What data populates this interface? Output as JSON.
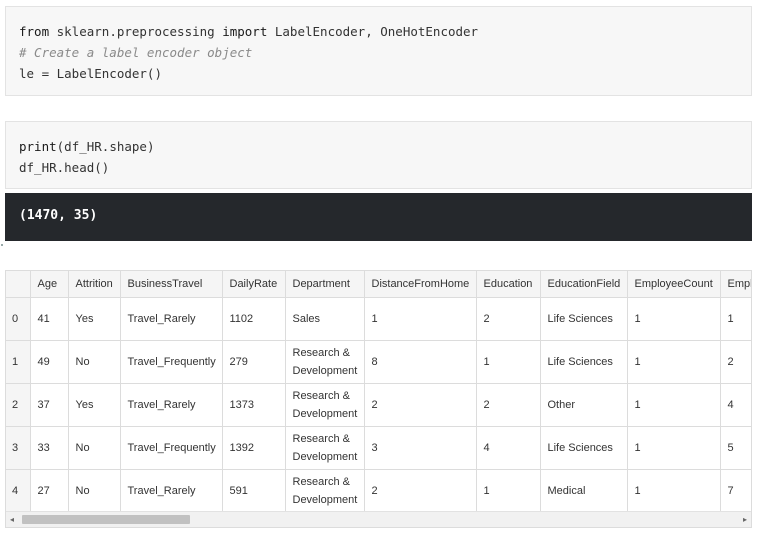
{
  "cell1": {
    "line1": {
      "kw1": "from",
      "t1": " sklearn.preprocessing ",
      "kw2": "import",
      "t2": " LabelEncoder, OneHotEncoder"
    },
    "line2": "# Create a label encoder object",
    "line3": "le = LabelEncoder()"
  },
  "cell2": {
    "line1": {
      "kw": "print",
      "t": "(df_HR.shape)"
    },
    "line2": "df_HR.head()"
  },
  "output_shape": "(1470, 35)",
  "table": {
    "columns": [
      "",
      "Age",
      "Attrition",
      "BusinessTravel",
      "DailyRate",
      "Department",
      "DistanceFromHome",
      "Education",
      "EducationField",
      "EmployeeCount",
      "Emplo"
    ],
    "rows": [
      [
        "0",
        "41",
        "Yes",
        "Travel_Rarely",
        "1102",
        "Sales",
        "1",
        "2",
        "Life Sciences",
        "1",
        "1"
      ],
      [
        "1",
        "49",
        "No",
        "Travel_Frequently",
        "279",
        "Research & Development",
        "8",
        "1",
        "Life Sciences",
        "1",
        "2"
      ],
      [
        "2",
        "37",
        "Yes",
        "Travel_Rarely",
        "1373",
        "Research & Development",
        "2",
        "2",
        "Other",
        "1",
        "4"
      ],
      [
        "3",
        "33",
        "No",
        "Travel_Frequently",
        "1392",
        "Research & Development",
        "3",
        "4",
        "Life Sciences",
        "1",
        "5"
      ],
      [
        "4",
        "27",
        "No",
        "Travel_Rarely",
        "591",
        "Research & Development",
        "2",
        "1",
        "Medical",
        "1",
        "7"
      ]
    ]
  },
  "scrollbar": {
    "left_arrow": "◂",
    "right_arrow": "▸",
    "position": 0.0,
    "visible_fraction": 0.22
  }
}
